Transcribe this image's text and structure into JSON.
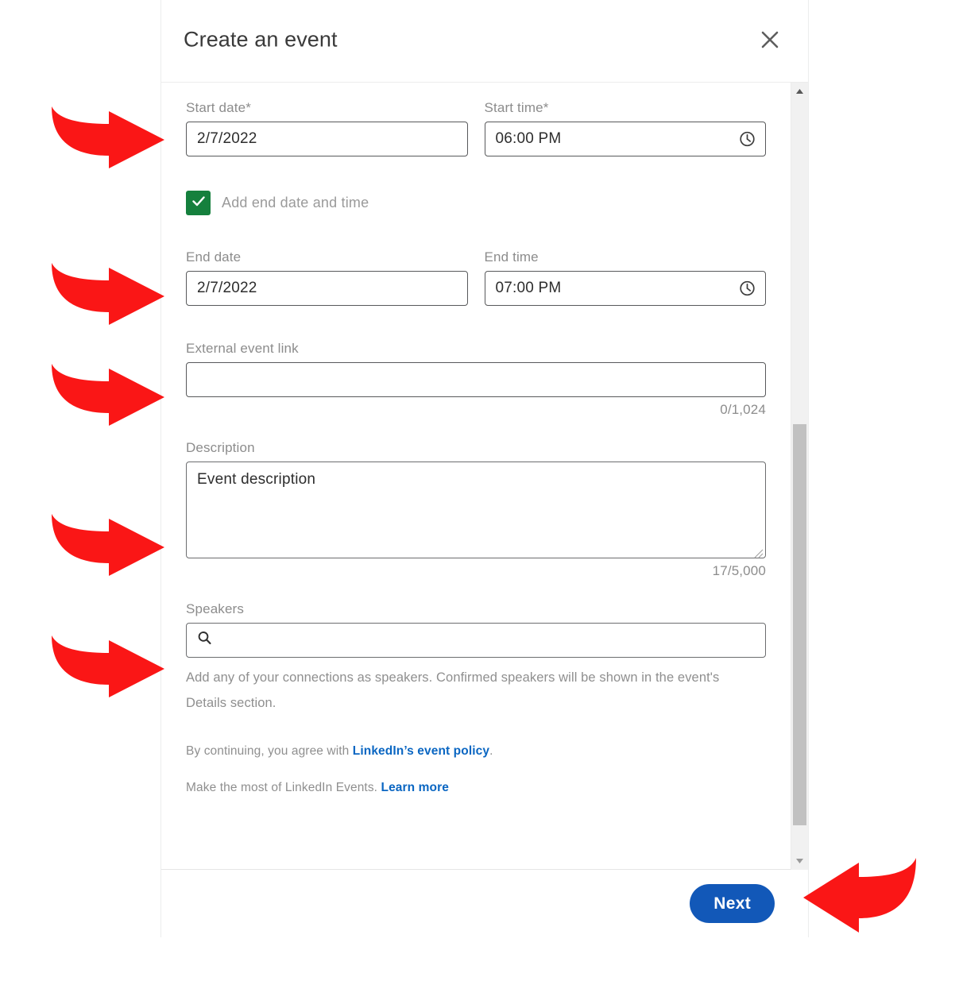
{
  "modal": {
    "title": "Create an event",
    "close_icon": "close-icon"
  },
  "form": {
    "start_date": {
      "label": "Start date",
      "required_marker": "*",
      "value": "2/7/2022"
    },
    "start_time": {
      "label": "Start time",
      "required_marker": "*",
      "value": "06:00 PM",
      "icon": "clock-icon"
    },
    "add_end": {
      "label": "Add end date and time",
      "checked": true,
      "check_color": "#15803d"
    },
    "end_date": {
      "label": "End date",
      "value": "2/7/2022"
    },
    "end_time": {
      "label": "End time",
      "value": "07:00 PM",
      "icon": "clock-icon"
    },
    "external_link": {
      "label": "External event link",
      "value": "",
      "placeholder": "",
      "counter": "0/1,024"
    },
    "description": {
      "label": "Description",
      "value": "Event description",
      "counter": "17/5,000"
    },
    "speakers": {
      "label": "Speakers",
      "value": "",
      "placeholder": "",
      "icon": "search-icon",
      "helper": "Add any of your connections as speakers. Confirmed speakers will be shown in the event's Details section."
    }
  },
  "legal": {
    "line1_prefix": "By continuing, you agree with ",
    "line1_link": "LinkedIn’s event policy",
    "line1_suffix": ".",
    "line2_prefix": "Make the most of LinkedIn Events. ",
    "line2_link": "Learn more"
  },
  "footer": {
    "next_label": "Next",
    "next_color": "#1258b8"
  },
  "scrollbar": {
    "up_icon": "caret-up-icon",
    "down_icon": "caret-down-icon"
  },
  "annotations": {
    "color": "#fa1616",
    "arrows": [
      {
        "name": "arrow-start-date",
        "direction": "right"
      },
      {
        "name": "arrow-end-date",
        "direction": "right"
      },
      {
        "name": "arrow-external-event-link",
        "direction": "right"
      },
      {
        "name": "arrow-description",
        "direction": "right"
      },
      {
        "name": "arrow-speakers",
        "direction": "right"
      },
      {
        "name": "arrow-next-button",
        "direction": "left"
      }
    ]
  }
}
